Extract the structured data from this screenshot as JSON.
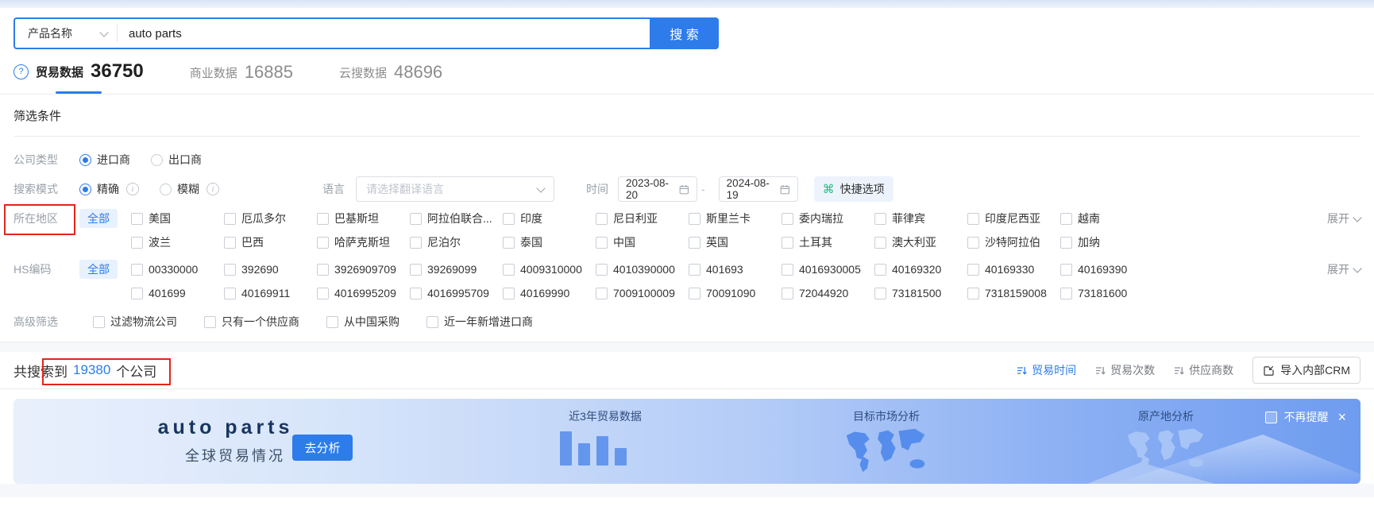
{
  "search": {
    "category": "产品名称",
    "query": "auto parts",
    "button": "搜 索"
  },
  "tabs": {
    "trade": {
      "label": "贸易数据",
      "count": "36750"
    },
    "business": {
      "label": "商业数据",
      "count": "16885"
    },
    "cloud": {
      "label": "云搜数据",
      "count": "48696"
    }
  },
  "filters": {
    "title": "筛选条件",
    "company_type": {
      "label": "公司类型",
      "importer": "进口商",
      "exporter": "出口商"
    },
    "search_mode": {
      "label": "搜索模式",
      "exact": "精确",
      "fuzzy": "模糊"
    },
    "language": {
      "label": "语言",
      "placeholder": "请选择翻译语言"
    },
    "time": {
      "label": "时间",
      "start": "2023-08-20",
      "separator": "-",
      "end": "2024-08-19"
    },
    "quick_options": "快捷选项",
    "region": {
      "label": "所在地区",
      "all": "全部",
      "expand": "展开",
      "row1": [
        "美国",
        "厄瓜多尔",
        "巴基斯坦",
        "阿拉伯联合...",
        "印度",
        "尼日利亚",
        "斯里兰卡",
        "委内瑞拉",
        "菲律宾",
        "印度尼西亚",
        "越南"
      ],
      "row2": [
        "波兰",
        "巴西",
        "哈萨克斯坦",
        "尼泊尔",
        "泰国",
        "中国",
        "英国",
        "土耳其",
        "澳大利亚",
        "沙特阿拉伯",
        "加纳"
      ]
    },
    "hs_code": {
      "label": "HS编码",
      "all": "全部",
      "expand": "展开",
      "row1": [
        "00330000",
        "392690",
        "3926909709",
        "39269099",
        "4009310000",
        "4010390000",
        "401693",
        "4016930005",
        "40169320",
        "40169330",
        "40169390"
      ],
      "row2": [
        "401699",
        "40169911",
        "4016995209",
        "4016995709",
        "40169990",
        "7009100009",
        "70091090",
        "72044920",
        "73181500",
        "7318159008",
        "73181600"
      ]
    },
    "advanced": {
      "label": "高级筛选",
      "options": [
        "过滤物流公司",
        "只有一个供应商",
        "从中国采购",
        "近一年新增进口商"
      ]
    }
  },
  "results": {
    "prefix": "共搜索到",
    "count": "19380",
    "suffix": "个公司",
    "sorts": [
      {
        "label": "贸易时间"
      },
      {
        "label": "贸易次数"
      },
      {
        "label": "供应商数"
      }
    ],
    "crm_button": "导入内部CRM"
  },
  "banner": {
    "product": "auto parts",
    "subtitle": "全球贸易情况",
    "analyze": "去分析",
    "trade_chart_title": "近3年贸易数据",
    "market_title": "目标市场分析",
    "origin_title": "原产地分析",
    "dismiss": "不再提醒",
    "close": "×",
    "bars": [
      43,
      28,
      37,
      22
    ]
  },
  "colors": {
    "primary": "#2d7cea",
    "annotation_red": "#e12619",
    "banner_gradient_start": "#e9f0fc",
    "banner_gradient_end": "#6f9cf0",
    "bar_blue": "#6496ee",
    "quick_icon_green": "#2fb980"
  }
}
